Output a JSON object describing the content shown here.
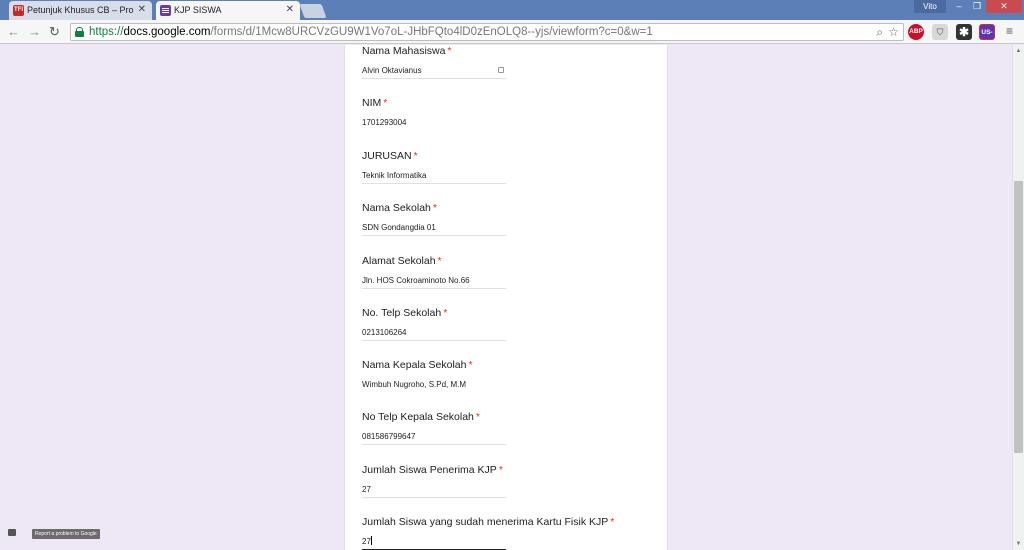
{
  "browser": {
    "tabs": [
      {
        "title": "Petunjuk Khusus CB – Pro",
        "favicon": "TFI"
      },
      {
        "title": "KJP SISWA",
        "favicon": "forms-icon"
      }
    ],
    "profile_name": "Vito",
    "url": {
      "scheme": "https://",
      "host": "docs.google.com",
      "path": "/forms/d/1Mcw8URCVzGU9W1Vo7oL-JHbFQto4lD0zEnOLQ8--yjs/viewform?c=0&w=1"
    },
    "extensions": [
      "ABP",
      "shield-icon",
      "puzzle-icon",
      "US-1"
    ]
  },
  "form": {
    "fields": [
      {
        "label": "Nama Mahasiswa",
        "value": "Alvin Oktavianus"
      },
      {
        "label": "NIM",
        "value": "1701293004"
      },
      {
        "label": "JURUSAN",
        "value": "Teknik Informatika"
      },
      {
        "label": "Nama Sekolah",
        "value": "SDN Gondangdia 01"
      },
      {
        "label": "Alamat Sekolah",
        "value": "Jln. HOS Cokroaminoto No.66"
      },
      {
        "label": "No. Telp Sekolah",
        "value": "0213106264"
      },
      {
        "label": "Nama Kepala Sekolah",
        "value": "Wimbuh Nugroho, S.Pd, M.M"
      },
      {
        "label": "No Telp Kepala Sekolah",
        "value": "081586799647"
      },
      {
        "label": "Jumlah Siswa Penerima KJP",
        "value": "27"
      },
      {
        "label": "Jumlah Siswa yang sudah menerima Kartu Fisik KJP",
        "value": "27"
      }
    ],
    "required_marker": "*"
  },
  "footer": {
    "report_label": "Report a problem to Google"
  },
  "colors": {
    "page_background": "#ede7f6",
    "required": "#d93025",
    "forms_accent": "#673ab7"
  }
}
